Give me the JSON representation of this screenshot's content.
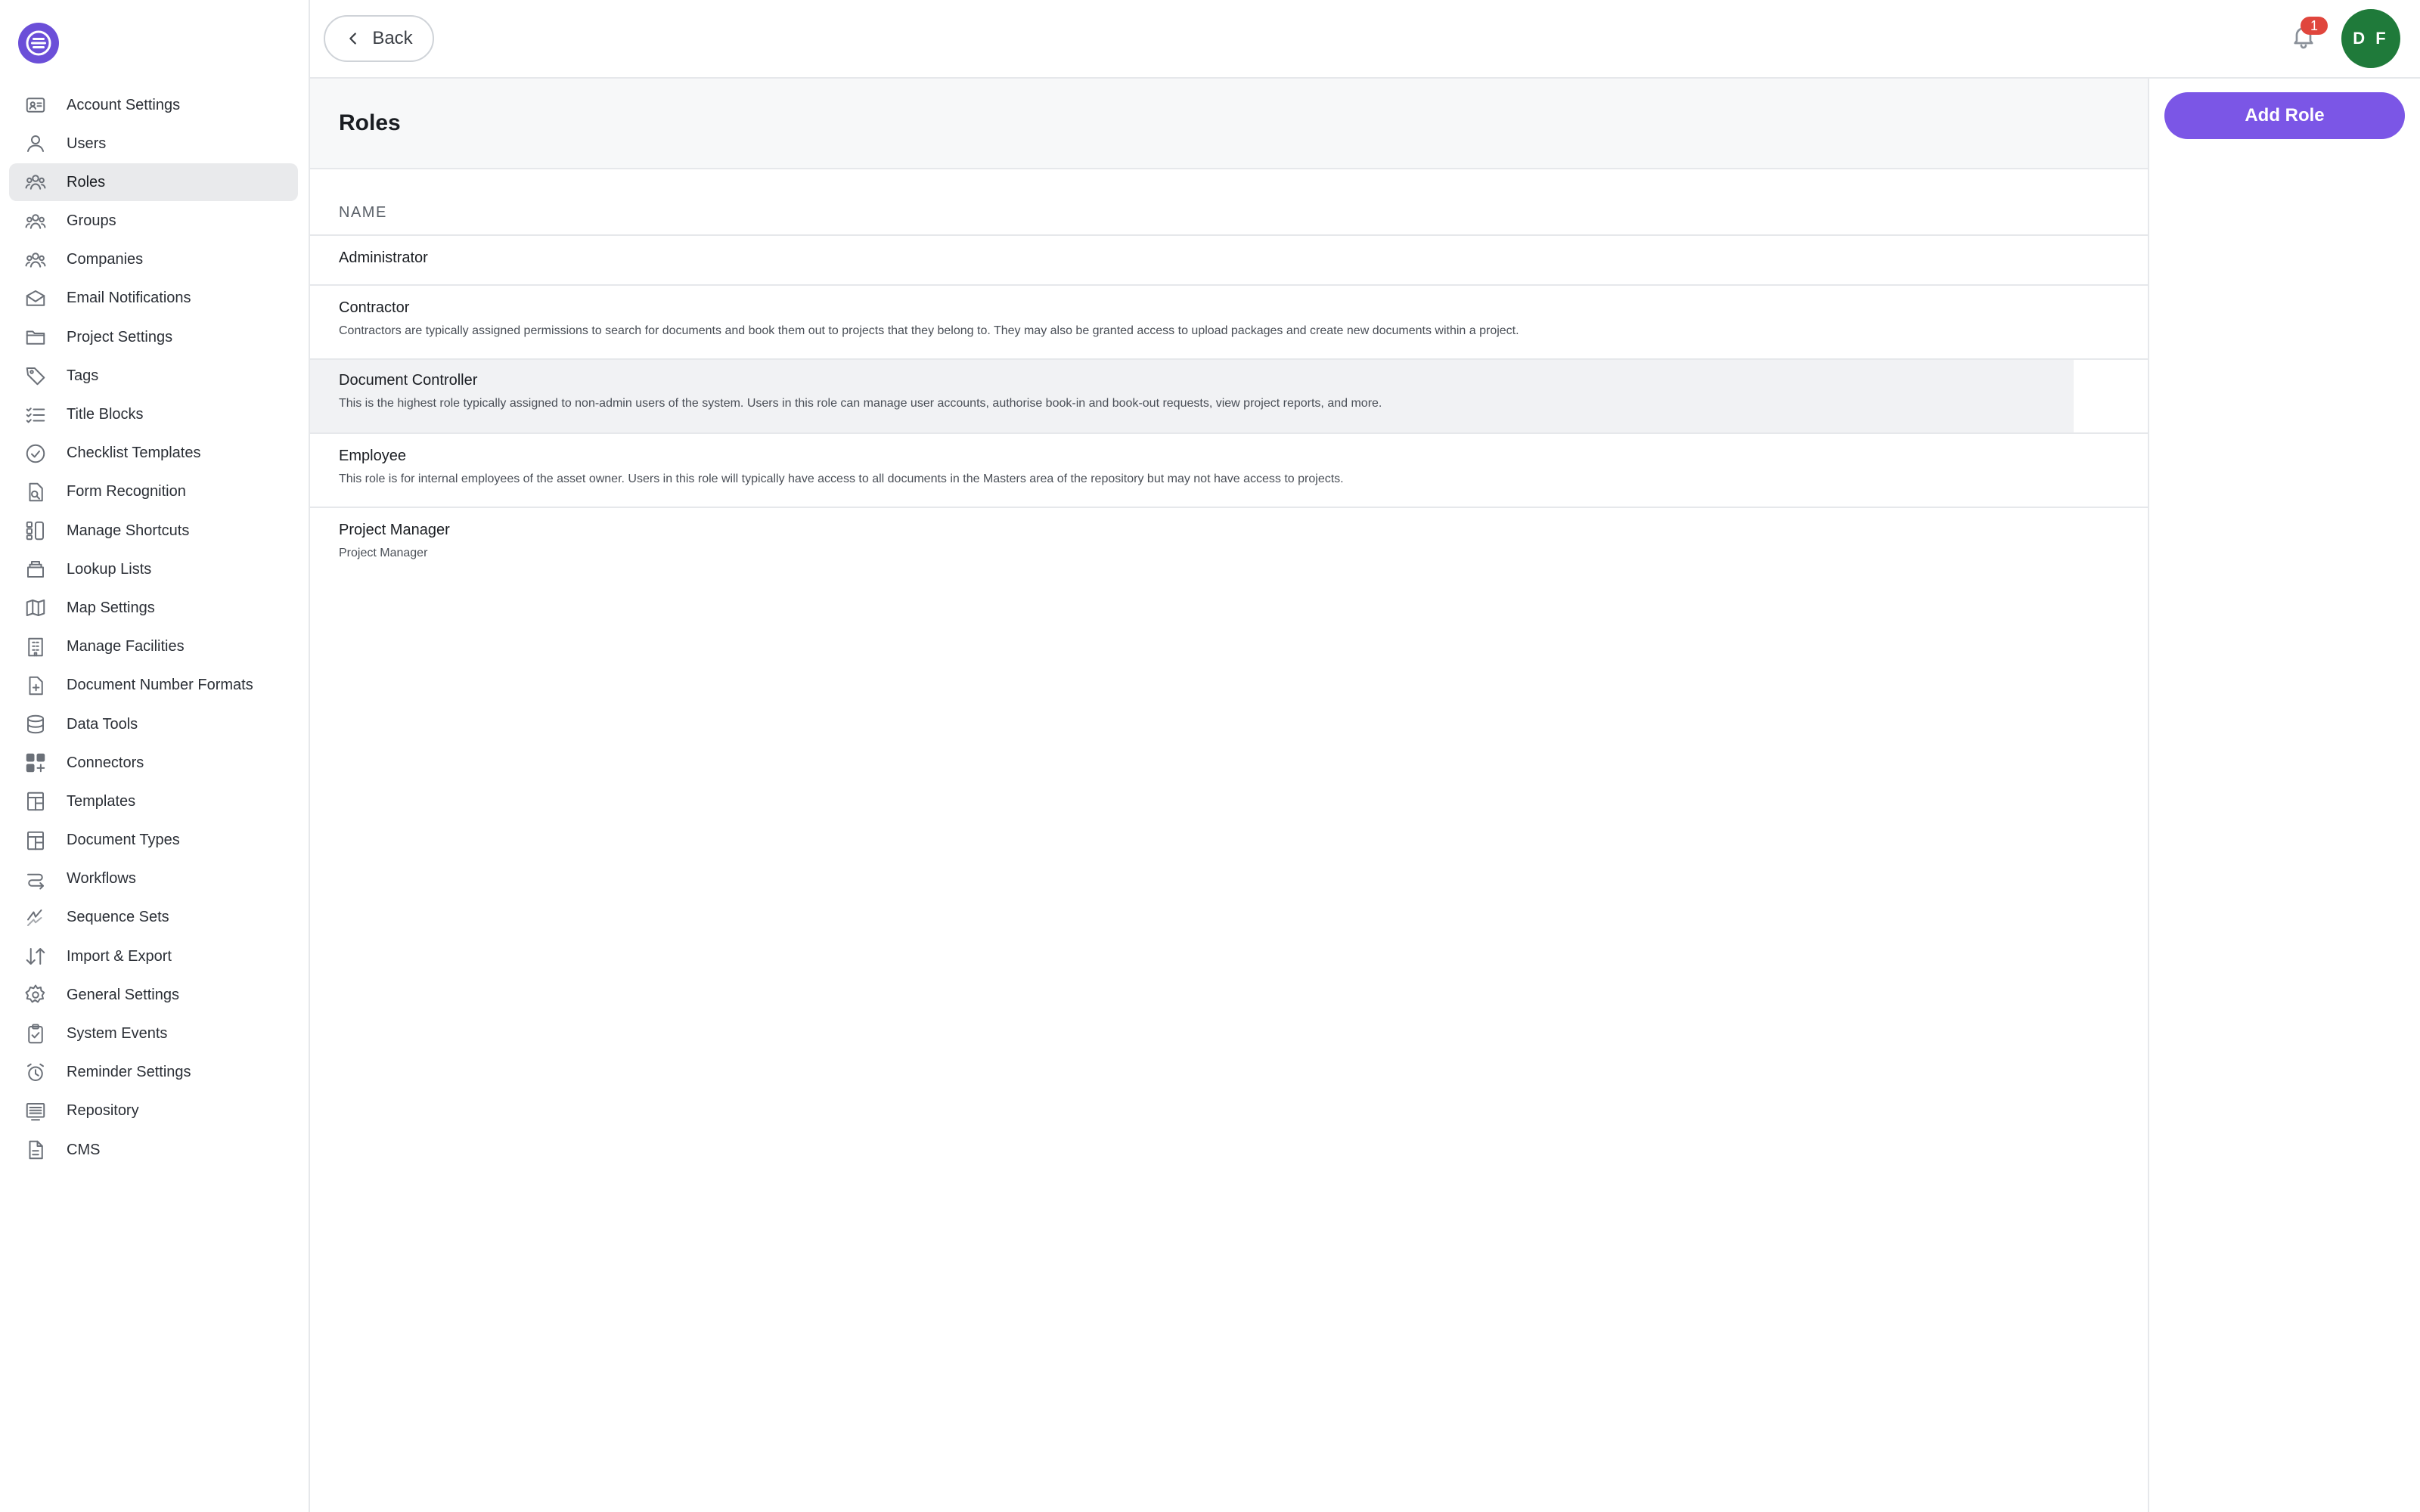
{
  "topbar": {
    "back_label": "Back",
    "notification_count": "1",
    "avatar_initials": "D F"
  },
  "sidebar": {
    "items": [
      {
        "label": "Account Settings",
        "icon": "id-card-icon"
      },
      {
        "label": "Users",
        "icon": "user-icon"
      },
      {
        "label": "Roles",
        "icon": "users-group-icon",
        "active": true
      },
      {
        "label": "Groups",
        "icon": "users-group-icon"
      },
      {
        "label": "Companies",
        "icon": "users-group-icon"
      },
      {
        "label": "Email Notifications",
        "icon": "mail-icon"
      },
      {
        "label": "Project Settings",
        "icon": "folder-icon"
      },
      {
        "label": "Tags",
        "icon": "tag-icon"
      },
      {
        "label": "Title Blocks",
        "icon": "list-check-icon"
      },
      {
        "label": "Checklist Templates",
        "icon": "check-circle-icon"
      },
      {
        "label": "Form Recognition",
        "icon": "file-search-icon"
      },
      {
        "label": "Manage Shortcuts",
        "icon": "shortcut-icon"
      },
      {
        "label": "Lookup Lists",
        "icon": "stack-icon"
      },
      {
        "label": "Map Settings",
        "icon": "map-icon"
      },
      {
        "label": "Manage Facilities",
        "icon": "building-icon"
      },
      {
        "label": "Document Number Formats",
        "icon": "file-plus-icon"
      },
      {
        "label": "Data Tools",
        "icon": "database-icon"
      },
      {
        "label": "Connectors",
        "icon": "apps-icon"
      },
      {
        "label": "Templates",
        "icon": "layout-icon"
      },
      {
        "label": "Document Types",
        "icon": "layout-icon"
      },
      {
        "label": "Workflows",
        "icon": "route-icon"
      },
      {
        "label": "Sequence Sets",
        "icon": "sequence-icon"
      },
      {
        "label": "Import & Export",
        "icon": "arrows-updown-icon"
      },
      {
        "label": "General Settings",
        "icon": "gear-icon"
      },
      {
        "label": "System Events",
        "icon": "clipboard-check-icon"
      },
      {
        "label": "Reminder Settings",
        "icon": "alarm-icon"
      },
      {
        "label": "Repository",
        "icon": "repository-icon"
      },
      {
        "label": "CMS",
        "icon": "file-text-icon"
      }
    ]
  },
  "main": {
    "title": "Roles",
    "column_header": "NAME",
    "rows": [
      {
        "name": "Administrator",
        "description": ""
      },
      {
        "name": "Contractor",
        "description": "Contractors are typically assigned permissions to search for documents and book them out to projects that they belong to. They may also be granted access to upload packages and create new documents within a project."
      },
      {
        "name": "Document Controller",
        "description": "This is the highest role typically assigned to non-admin users of the system. Users in this role can manage user accounts, authorise book-in and book-out requests, view project reports, and more."
      },
      {
        "name": "Employee",
        "description": "This role is for internal employees of the asset owner. Users in this role will typically have access to all documents in the Masters area of the repository but may not have access to projects."
      },
      {
        "name": "Project Manager",
        "description": "Project Manager"
      }
    ]
  },
  "actions": {
    "add_role_label": "Add Role"
  },
  "colors": {
    "accent": "#7b56e6",
    "avatar": "#1f7a3a",
    "badge": "#e0463d"
  }
}
